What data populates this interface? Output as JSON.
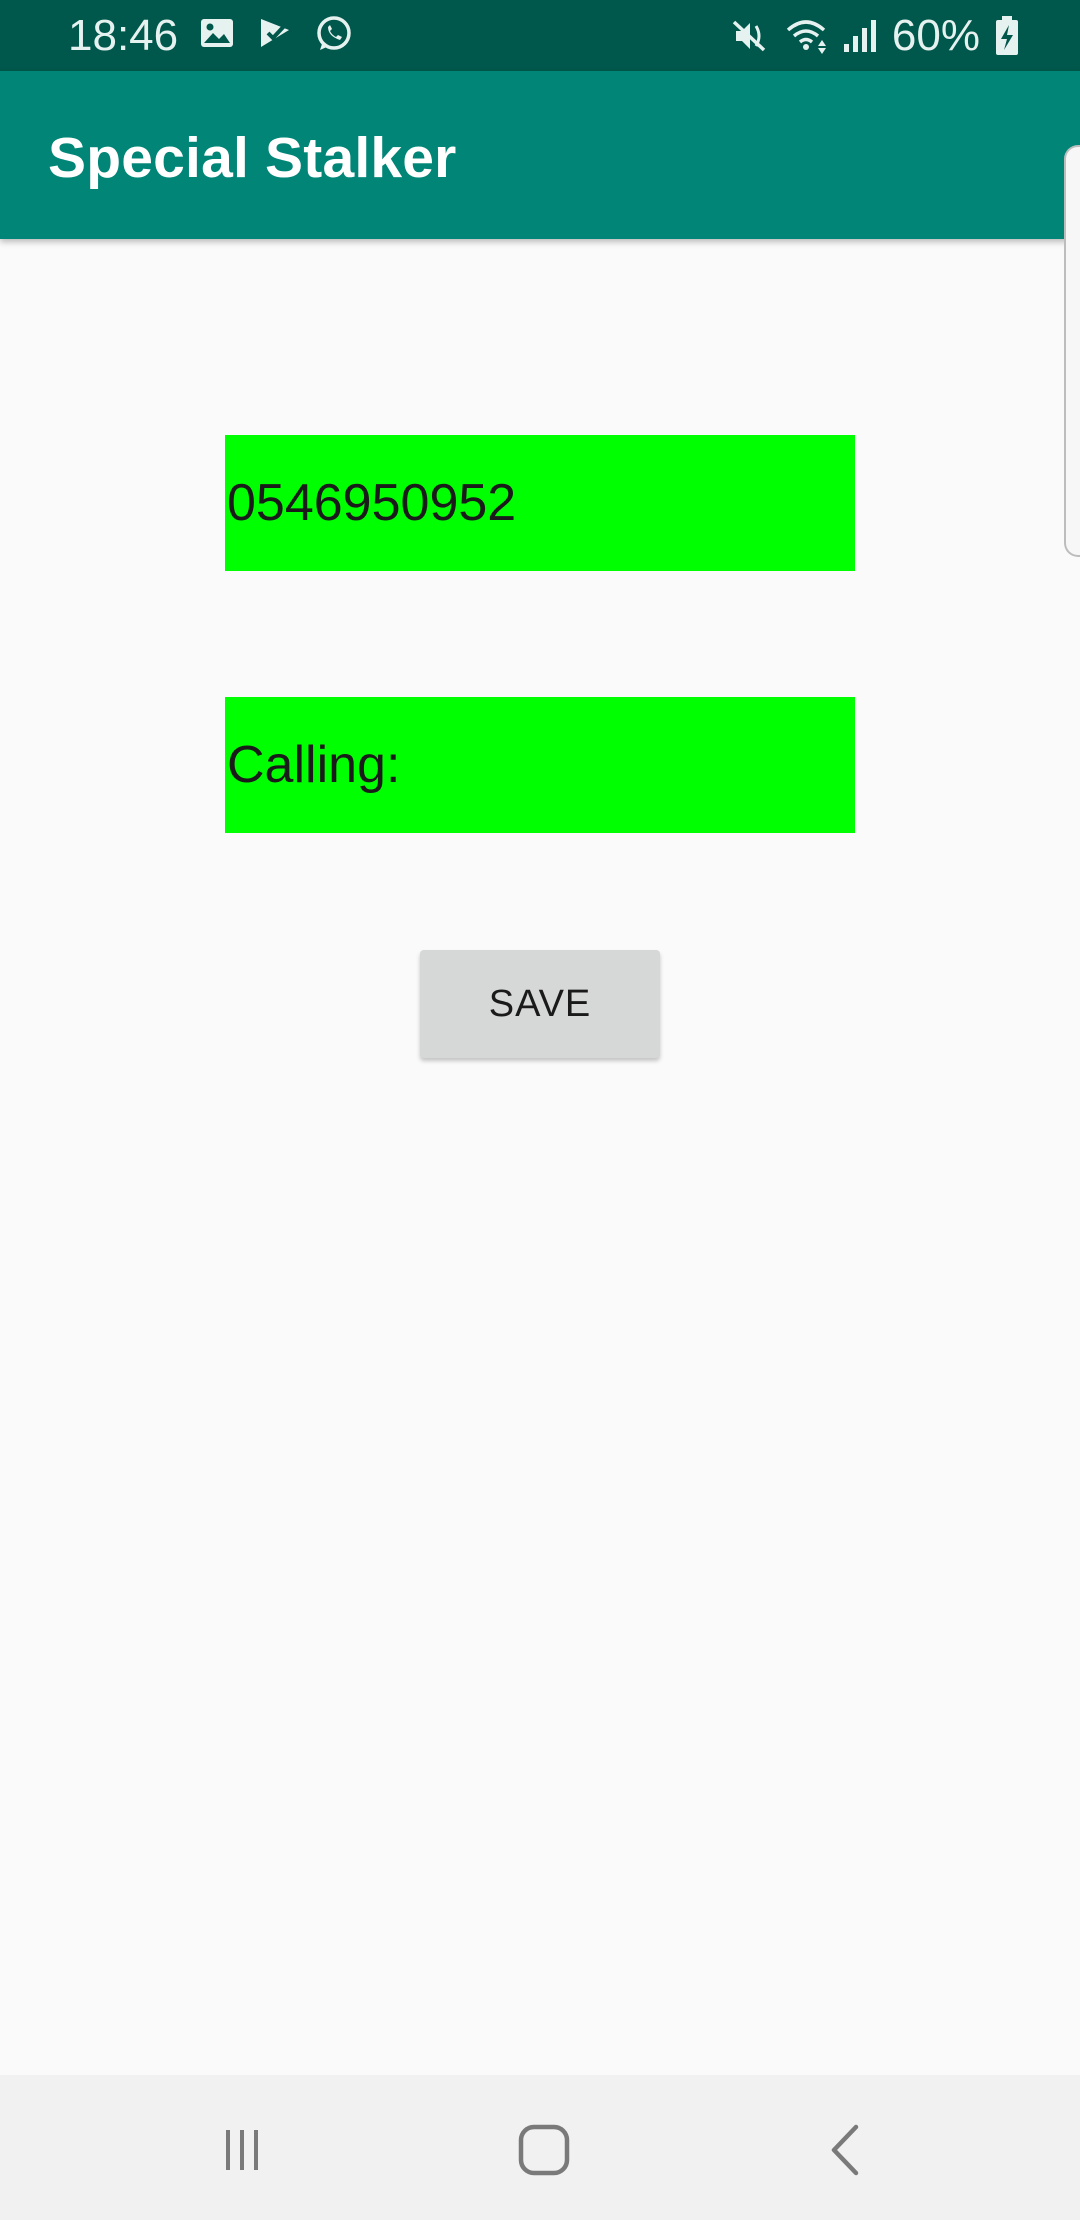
{
  "status_bar": {
    "time": "18:46",
    "battery_percent": "60%",
    "left_icons": [
      "gallery-icon",
      "check-flag-icon",
      "whatsapp-icon"
    ],
    "right_icons": [
      "mute-icon",
      "wifi-icon",
      "signal-icon",
      "battery-charging-icon"
    ]
  },
  "app_bar": {
    "title": "Special Stalker"
  },
  "form": {
    "phone_value": "0546950952",
    "calling_label": "Calling:",
    "save_label": "SAVE"
  },
  "nav_bar": {
    "icons": [
      "recents-icon",
      "home-icon",
      "back-icon"
    ]
  },
  "colors": {
    "status_bar": "#00574b",
    "app_bar": "#008577",
    "field_background": "#00ff00",
    "button_background": "#d6d7d7",
    "page_background": "#fafafa"
  }
}
